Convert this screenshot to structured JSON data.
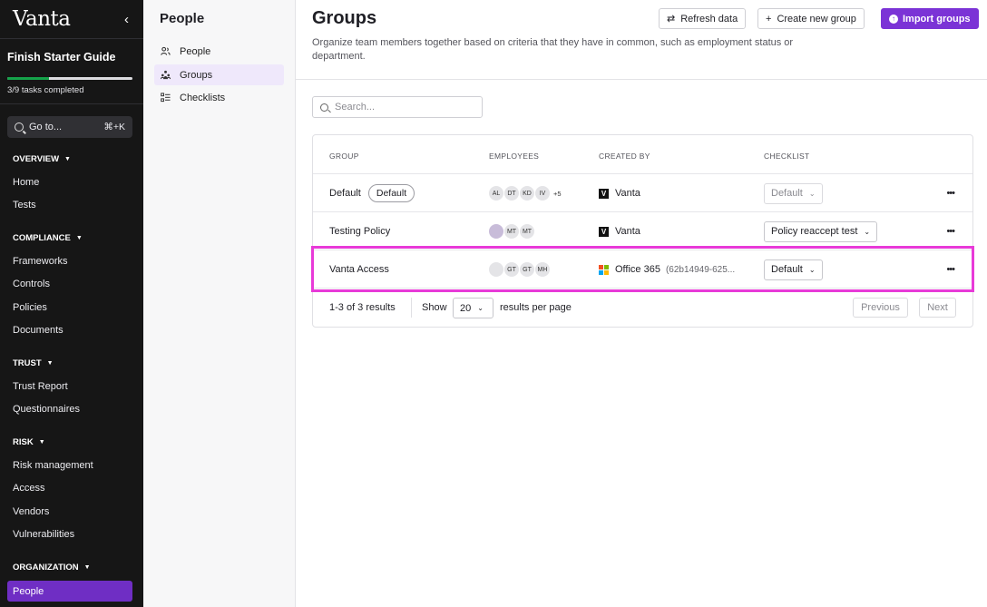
{
  "sidebar": {
    "logo": "Vanta",
    "collapse_icon": "‹",
    "guide_title": "Finish Starter Guide",
    "guide_progress": 0.333,
    "guide_subtitle": "3/9 tasks completed",
    "goto_label": "Go to...",
    "goto_shortcut": "⌘+K",
    "sections": {
      "overview": "OVERVIEW",
      "compliance": "COMPLIANCE",
      "trust": "TRUST",
      "risk": "RISK",
      "organization": "ORGANIZATION"
    },
    "items": {
      "home": "Home",
      "tests": "Tests",
      "frameworks": "Frameworks",
      "controls": "Controls",
      "policies": "Policies",
      "documents": "Documents",
      "trust_report": "Trust Report",
      "questionnaires": "Questionnaires",
      "risk_management": "Risk management",
      "access": "Access",
      "vendors": "Vendors",
      "vulnerabilities": "Vulnerabilities",
      "people": "People"
    }
  },
  "subnav": {
    "title": "People",
    "items": [
      "People",
      "Groups",
      "Checklists"
    ],
    "active_index": 1
  },
  "header": {
    "title": "Groups",
    "description": "Organize team members together based on criteria that they have in common, such as employment status or department.",
    "refresh_label": "Refresh data",
    "create_label": "Create new group",
    "import_label": "Import groups"
  },
  "search": {
    "placeholder": "Search..."
  },
  "table": {
    "columns": [
      "GROUP",
      "EMPLOYEES",
      "CREATED BY",
      "CHECKLIST"
    ],
    "rows": [
      {
        "name": "Default",
        "badge": "Default",
        "avatars": [
          "AL",
          "DT",
          "KD",
          "IV"
        ],
        "more": "+5",
        "creator": "Vanta",
        "checklist": "Default"
      },
      {
        "name": "Testing Policy",
        "avatars": [
          "",
          "MT",
          "MT"
        ],
        "creator": "Vanta",
        "checklist": "Policy reaccept test"
      },
      {
        "name": "Vanta Access",
        "avatars": [
          "",
          "GT",
          "GT",
          "MH"
        ],
        "creator": "Office 365",
        "creator_id": "(62b14949-625...",
        "checklist": "Default"
      }
    ],
    "kebab": "•••"
  },
  "pagination": {
    "count": "1-3 of 3 results",
    "show": "Show",
    "per_page": "20",
    "per_page_label": "results per page",
    "previous": "Previous",
    "next": "Next"
  },
  "colors": {
    "accent": "#7b33d6",
    "highlight": "#e83ad8",
    "progress": "#15a34a"
  }
}
